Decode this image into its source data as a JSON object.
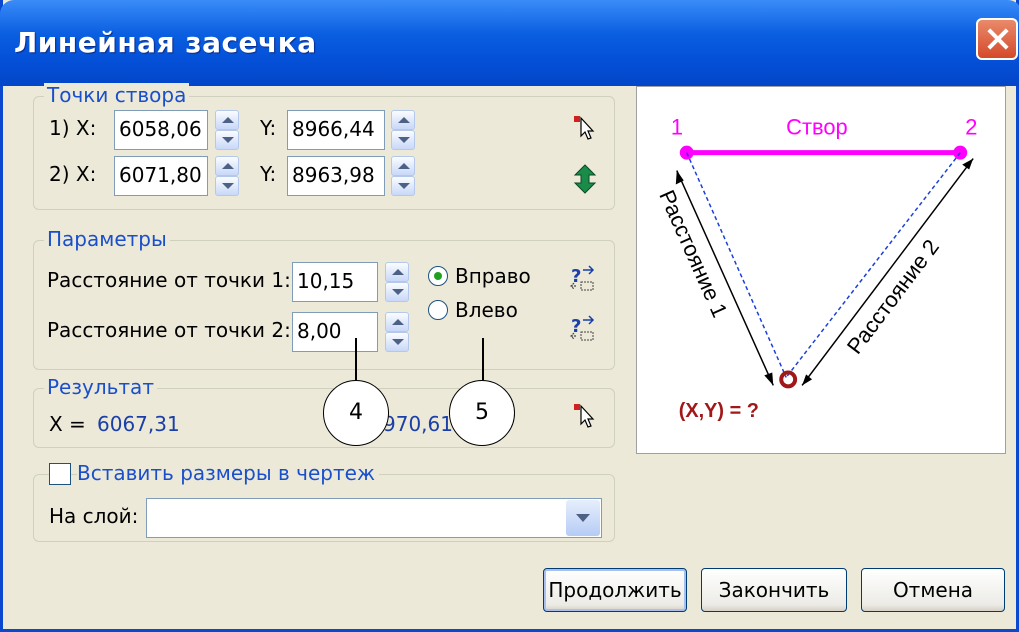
{
  "window": {
    "title": "Линейная засечка"
  },
  "points": {
    "legend": "Точки створа",
    "p1": {
      "label_x": "1) X:",
      "x": "6058,06",
      "label_y": "Y:",
      "y": "8966,44"
    },
    "p2": {
      "label_x": "2) X:",
      "x": "6071,80",
      "label_y": "Y:",
      "y": "8963,98"
    }
  },
  "params": {
    "legend": "Параметры",
    "dist1": {
      "label": "Расстояние от точки 1:",
      "value": "10,15"
    },
    "dist2": {
      "label": "Расстояние от точки 2:",
      "value": "8,00"
    },
    "radio_right": {
      "label": "Вправо",
      "checked": true
    },
    "radio_left": {
      "label": "Влево",
      "checked": false
    }
  },
  "result": {
    "legend": "Результат",
    "x_label": "X =",
    "x_value": "6067,31",
    "y_value_partial": "970,61"
  },
  "insert": {
    "checkbox_label": "Вставить размеры в чертеж",
    "checked": false,
    "layer_label": "На слой:",
    "layer_value": ""
  },
  "buttons": {
    "continue": "Продолжить",
    "finish": "Закончить",
    "cancel": "Отмена"
  },
  "callouts": [
    "4",
    "5"
  ],
  "diagram": {
    "point1": "1",
    "point2": "2",
    "baseline": "Створ",
    "distance1": "Расстояние 1",
    "distance2": "Расстояние 2",
    "unknown": "(X,Y) = ?",
    "colors": {
      "magenta": "#FF00FF",
      "darkred": "#A01818",
      "blue": "#1A3FD8"
    }
  }
}
